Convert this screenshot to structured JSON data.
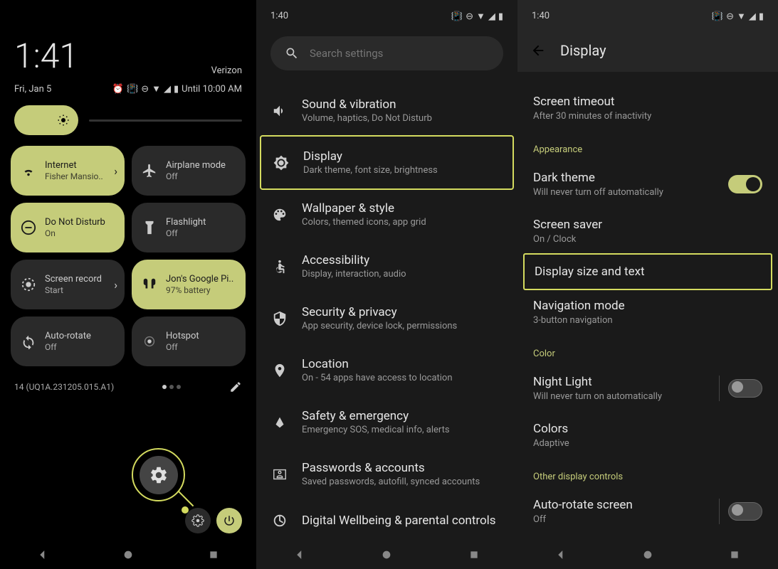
{
  "screen1": {
    "time": "1:41",
    "carrier": "Verizon",
    "date": "Fri, Jan 5",
    "until": "Until 10:00 AM",
    "tiles": [
      {
        "title": "Internet",
        "sub": "Fisher Mansio..",
        "active": true,
        "chevron": true
      },
      {
        "title": "Airplane mode",
        "sub": "Off",
        "active": false
      },
      {
        "title": "Do Not Disturb",
        "sub": "On",
        "active": true
      },
      {
        "title": "Flashlight",
        "sub": "Off",
        "active": false
      },
      {
        "title": "Screen record",
        "sub": "Start",
        "active": false,
        "chevron": true
      },
      {
        "title": "Jon's Google Pi..",
        "sub": "97% battery",
        "active": true
      },
      {
        "title": "Auto-rotate",
        "sub": "Off",
        "active": false
      },
      {
        "title": "Hotspot",
        "sub": "Off",
        "active": false
      }
    ],
    "build": "14 (UQ1A.231205.015.A1)"
  },
  "screen2": {
    "time": "1:40",
    "search_placeholder": "Search settings",
    "items": [
      {
        "title": "Sound & vibration",
        "sub": "Volume, haptics, Do Not Disturb"
      },
      {
        "title": "Display",
        "sub": "Dark theme, font size, brightness",
        "highlighted": true
      },
      {
        "title": "Wallpaper & style",
        "sub": "Colors, themed icons, app grid"
      },
      {
        "title": "Accessibility",
        "sub": "Display, interaction, audio"
      },
      {
        "title": "Security & privacy",
        "sub": "App security, device lock, permissions"
      },
      {
        "title": "Location",
        "sub": "On - 54 apps have access to location"
      },
      {
        "title": "Safety & emergency",
        "sub": "Emergency SOS, medical info, alerts"
      },
      {
        "title": "Passwords & accounts",
        "sub": "Saved passwords, autofill, synced accounts"
      },
      {
        "title": "Digital Wellbeing & parental controls",
        "sub": ""
      }
    ]
  },
  "screen3": {
    "time": "1:40",
    "header": "Display",
    "timeout_title": "Screen timeout",
    "timeout_sub": "After 30 minutes of inactivity",
    "section_appearance": "Appearance",
    "dark_title": "Dark theme",
    "dark_sub": "Will never turn off automatically",
    "saver_title": "Screen saver",
    "saver_sub": "On / Clock",
    "size_title": "Display size and text",
    "nav_title": "Navigation mode",
    "nav_sub": "3-button navigation",
    "section_color": "Color",
    "night_title": "Night Light",
    "night_sub": "Will never turn on automatically",
    "colors_title": "Colors",
    "colors_sub": "Adaptive",
    "section_other": "Other display controls",
    "auto_title": "Auto-rotate screen",
    "auto_sub": "Off"
  }
}
